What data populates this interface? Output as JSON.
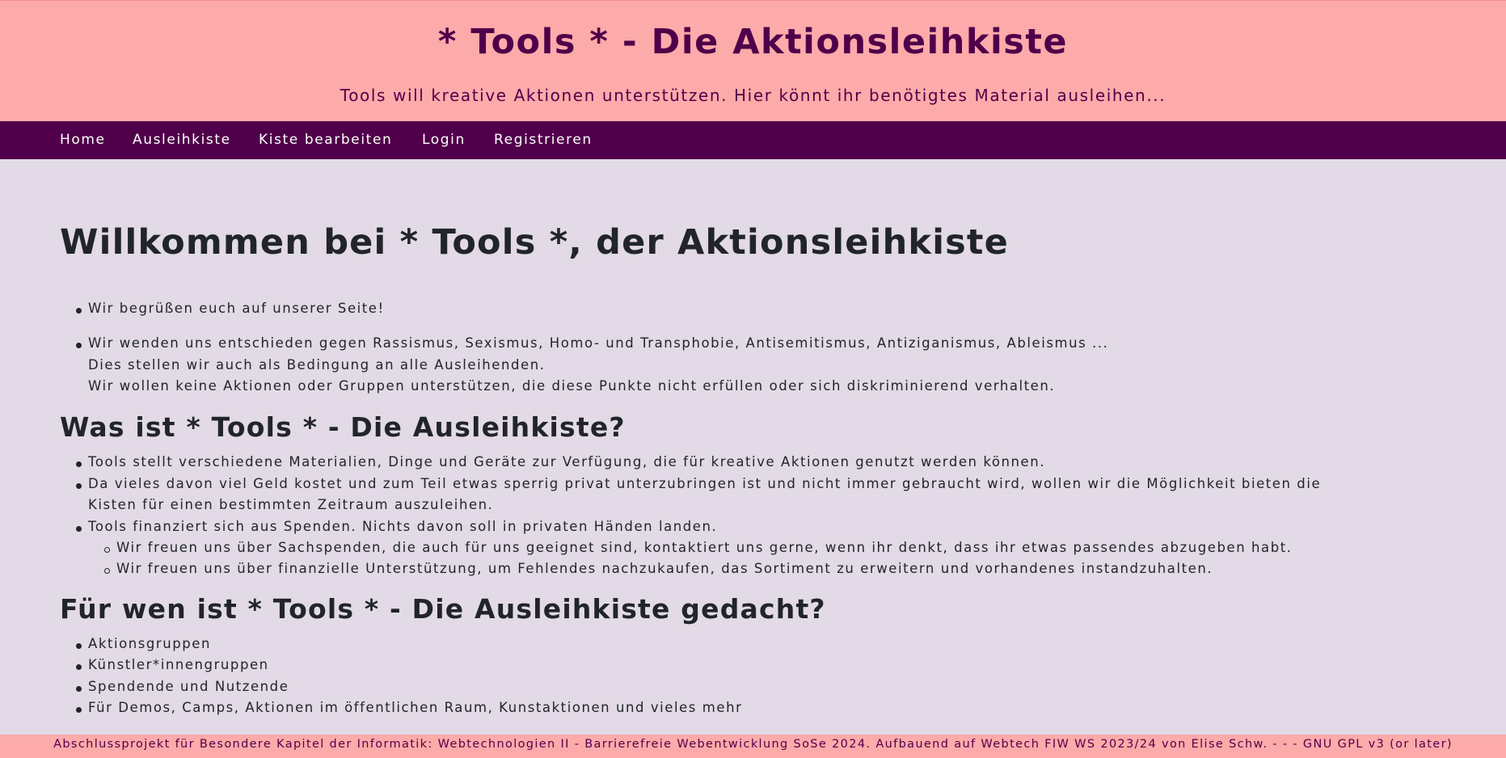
{
  "header": {
    "title": "* Tools * - Die Aktionsleihkiste",
    "subtitle": "Tools will kreative Aktionen unterstützen. Hier könnt ihr benötigtes Material ausleihen..."
  },
  "nav": {
    "items": [
      {
        "label": "Home"
      },
      {
        "label": "Ausleihkiste"
      },
      {
        "label": "Kiste bearbeiten"
      },
      {
        "label": "Login"
      },
      {
        "label": "Registrieren"
      }
    ]
  },
  "main": {
    "heading": "Willkommen bei * Tools *, der Aktionsleihkiste",
    "intro": [
      "Wir begrüßen euch auf unserer Seite!",
      "Wir wenden uns entschieden gegen Rassismus, Sexismus, Homo- und Transphobie, Antisemitismus, Antiziganismus, Ableismus ...",
      "Dies stellen wir auch als Bedingung an alle Ausleihenden.",
      "Wir wollen keine Aktionen oder Gruppen unterstützen, die diese Punkte nicht erfüllen oder sich diskriminierend verhalten."
    ],
    "section1": {
      "heading": "Was ist * Tools * - Die Ausleihkiste?",
      "items": [
        "Tools stellt verschiedene Materialien, Dinge und Geräte zur Verfügung, die für kreative Aktionen genutzt werden können.",
        "Da vieles davon viel Geld kostet und zum Teil etwas sperrig privat unterzubringen ist und nicht immer gebraucht wird, wollen wir die Möglichkeit bieten die",
        "Kisten für einen bestimmten Zeitraum auszuleihen.",
        "Tools finanziert sich aus Spenden. Nichts davon soll in privaten Händen landen."
      ],
      "subitems": [
        "Wir freuen uns über Sachspenden, die auch für uns geeignet sind, kontaktiert uns gerne, wenn ihr denkt, dass ihr etwas passendes abzugeben habt.",
        "Wir freuen uns über finanzielle Unterstützung, um Fehlendes nachzukaufen, das Sortiment zu erweitern und vorhandenes instandzuhalten."
      ]
    },
    "section2": {
      "heading": "Für wen ist * Tools * - Die Ausleihkiste gedacht?",
      "items": [
        "Aktionsgruppen",
        "Künstler*innengruppen",
        "Spendende und Nutzende",
        "Für Demos, Camps, Aktionen im öffentlichen Raum, Kunstaktionen und vieles mehr"
      ]
    }
  },
  "footer": {
    "text": "Abschlussprojekt für Besondere Kapitel der Informatik: Webtechnologien II - Barrierefreie Webentwicklung SoSe 2024. Aufbauend auf Webtech FIW WS 2023/24 von Elise Schw. - - - GNU GPL v3 (or later)"
  },
  "colors": {
    "header_bg": "#fdaaaa",
    "accent": "#50004a",
    "page_bg": "#e2dae6",
    "text": "#212529"
  }
}
